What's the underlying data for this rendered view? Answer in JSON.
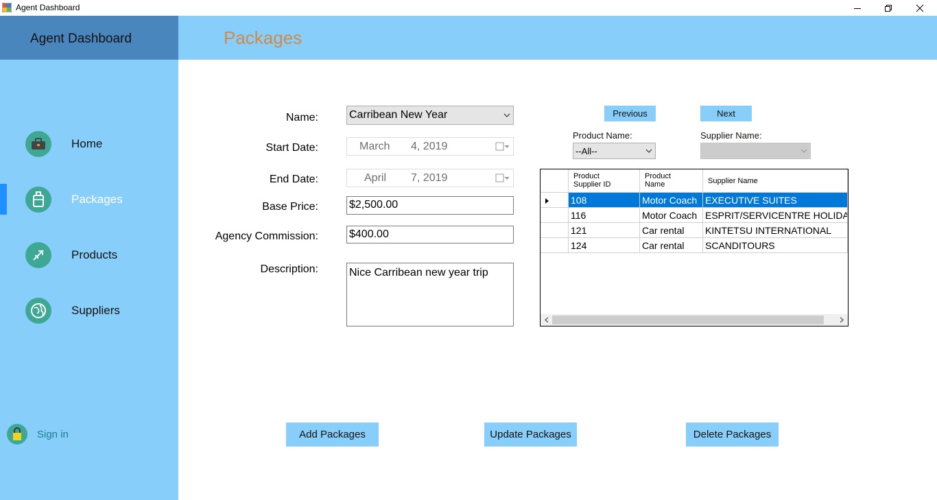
{
  "window": {
    "title": "Agent Dashboard"
  },
  "sidebar": {
    "title": "Agent Dashboard",
    "items": [
      {
        "label": "Home",
        "icon": "briefcase-icon"
      },
      {
        "label": "Packages",
        "icon": "luggage-icon",
        "active": true
      },
      {
        "label": "Products",
        "icon": "airplane-icon"
      },
      {
        "label": "Suppliers",
        "icon": "globe-icon"
      }
    ],
    "sign_in": "Sign in"
  },
  "header": {
    "page_title": "Packages"
  },
  "form": {
    "name_label": "Name:",
    "name_value": "Carribean New Year",
    "start_label": "Start Date:",
    "start_month": "March",
    "start_rest": "4, 2019",
    "end_label": "End Date:",
    "end_month": "April",
    "end_rest": "7, 2019",
    "base_label": "Base Price:",
    "base_value": "$2,500.00",
    "commission_label": "Agency Commission:",
    "commission_value": "$400.00",
    "description_label": "Description:",
    "description_value": "Nice Carribean new year trip"
  },
  "nav_buttons": {
    "previous": "Previous",
    "next": "Next"
  },
  "filters": {
    "product_label": "Product Name:",
    "product_value": "--All--",
    "supplier_label": "Supplier Name:",
    "supplier_value": ""
  },
  "grid": {
    "headers": [
      "Product Supplier ID",
      "Product Name",
      "Supplier Name"
    ],
    "header_lines": [
      [
        "Product",
        "Supplier ID"
      ],
      [
        "Product",
        "Name"
      ],
      [
        "Supplier Name"
      ]
    ],
    "rows": [
      {
        "id": "108",
        "product": "Motor Coach",
        "supplier": "EXECUTIVE SUITES",
        "selected": true
      },
      {
        "id": "116",
        "product": "Motor Coach",
        "supplier": "ESPRIT/SERVICENTRE HOLIDAY"
      },
      {
        "id": "121",
        "product": "Car rental",
        "supplier": "KINTETSU INTERNATIONAL"
      },
      {
        "id": "124",
        "product": "Car rental",
        "supplier": "SCANDITOURS"
      }
    ]
  },
  "actions": {
    "add": "Add Packages",
    "update": "Update Packages",
    "delete": "Delete Packages"
  },
  "colors": {
    "sidebar": "#87cefa",
    "sidebar_header": "#4a86be",
    "accent_title": "#d08a4a",
    "icon_circle": "#3fa895",
    "selection": "#0078d7"
  }
}
